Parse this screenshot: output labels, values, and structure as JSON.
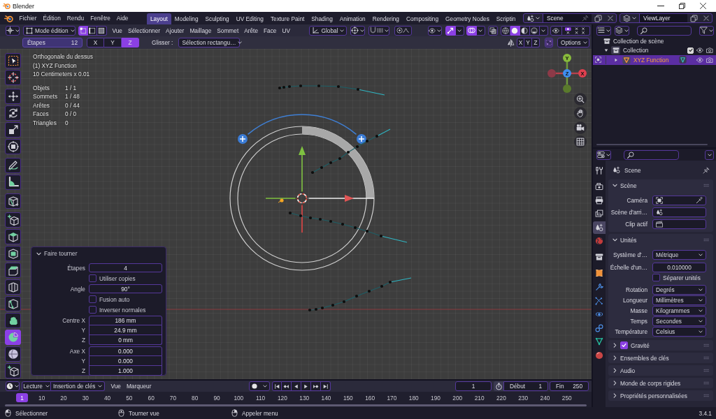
{
  "window": {
    "title": "Blender"
  },
  "menu_bar": {
    "menus": [
      "Fichier",
      "Édition",
      "Rendu",
      "Fenêtre",
      "Aide"
    ],
    "workspaces": [
      {
        "label": "Layout",
        "selected": true
      },
      {
        "label": "Modeling",
        "selected": false
      },
      {
        "label": "Sculpting",
        "selected": false
      },
      {
        "label": "UV Editing",
        "selected": false
      },
      {
        "label": "Texture Paint",
        "selected": false
      },
      {
        "label": "Shading",
        "selected": false
      },
      {
        "label": "Animation",
        "selected": false
      },
      {
        "label": "Rendering",
        "selected": false
      },
      {
        "label": "Compositing",
        "selected": false
      },
      {
        "label": "Geometry Nodes",
        "selected": false
      },
      {
        "label": "Scriptin",
        "selected": false
      }
    ],
    "scene": "Scene",
    "view_layer": "ViewLayer"
  },
  "viewport_header": {
    "mode": "Mode édition",
    "select_modes": [
      {
        "kind": "vertex",
        "selected": true
      },
      {
        "kind": "edge",
        "selected": false
      },
      {
        "kind": "face",
        "selected": false
      }
    ],
    "menus": [
      "Vue",
      "Sélectionner",
      "Ajouter",
      "Maillage",
      "Sommet",
      "Arête",
      "Face",
      "UV"
    ],
    "orientation": "Global",
    "toggles": [
      {
        "kind": "gizmo",
        "on": true
      },
      {
        "kind": "overlays",
        "on": true
      },
      {
        "kind": "xray",
        "on": false
      }
    ],
    "shading_modes": [
      {
        "kind": "wireframe",
        "selected": false
      },
      {
        "kind": "solid",
        "selected": true
      },
      {
        "kind": "material",
        "selected": false
      },
      {
        "kind": "rendered",
        "selected": false
      }
    ]
  },
  "tool_settings": {
    "steps_label": "Étapes",
    "steps": "12",
    "axes": [
      {
        "label": "X",
        "selected": false
      },
      {
        "label": "Y",
        "selected": false
      },
      {
        "label": "Z",
        "selected": true
      }
    ],
    "drag_label": "Glisser :",
    "drag_value": "Sélection rectangu…",
    "mirror_axes": [
      "X",
      "Y",
      "Z"
    ],
    "options": "Options"
  },
  "viewport": {
    "view_info": [
      "Orthogonale du dessus",
      "(1) XYZ Function",
      "10 Centimeters x 0.01"
    ],
    "stats": [
      {
        "label": "Objets",
        "value": "1 / 1"
      },
      {
        "label": "Sommets",
        "value": "1 / 48"
      },
      {
        "label": "Arêtes",
        "value": "0 / 44"
      },
      {
        "label": "Faces",
        "value": "0 / 0"
      },
      {
        "label": "Triangles",
        "value": "0"
      }
    ],
    "nav_gizmo": {
      "x": "X",
      "y": "Y",
      "z": "Z"
    }
  },
  "toolbar": {
    "groups": [
      {
        "tools": [
          {
            "kind": "select-box",
            "selected": false
          },
          {
            "kind": "cursor",
            "selected": false
          }
        ]
      },
      {
        "tools": [
          {
            "kind": "move",
            "selected": false
          },
          {
            "kind": "rotate",
            "selected": false
          },
          {
            "kind": "scale",
            "selected": false
          },
          {
            "kind": "transform",
            "selected": false
          }
        ]
      },
      {
        "tools": [
          {
            "kind": "annotate",
            "selected": false
          },
          {
            "kind": "measure",
            "selected": false
          }
        ]
      },
      {
        "tools": [
          {
            "kind": "cube-line",
            "selected": false
          }
        ]
      },
      {
        "tools": [
          {
            "kind": "cube-add",
            "selected": false
          },
          {
            "kind": "extrude",
            "selected": false
          },
          {
            "kind": "inset",
            "selected": false
          },
          {
            "kind": "bevel",
            "selected": false
          },
          {
            "kind": "loop-cut",
            "selected": false
          },
          {
            "kind": "knife",
            "selected": false
          },
          {
            "kind": "poly-build",
            "selected": false
          },
          {
            "kind": "spin",
            "selected": true
          },
          {
            "kind": "smooth",
            "selected": false
          },
          {
            "kind": "cube-add",
            "selected": false
          }
        ]
      }
    ]
  },
  "operator_panel": {
    "title": "Faire tourner",
    "expanded": true,
    "rows": [
      {
        "kind": "number",
        "label": "Étapes",
        "value": "4"
      },
      {
        "kind": "checkbox",
        "label": "Utiliser copies",
        "checked": false
      },
      {
        "kind": "number",
        "label": "Angle",
        "value": "90°"
      },
      {
        "kind": "checkbox",
        "label": "Fusion auto",
        "checked": false
      },
      {
        "kind": "checkbox",
        "label": "Inverser normales",
        "checked": false
      }
    ],
    "vectors": [
      {
        "rows": [
          {
            "label": "Centre X",
            "value": "186 mm"
          },
          {
            "label": "Y",
            "value": "24.9 mm"
          },
          {
            "label": "Z",
            "value": "0 mm"
          }
        ]
      },
      {
        "rows": [
          {
            "label": "Axe X",
            "value": "0.000"
          },
          {
            "label": "Y",
            "value": "0.000"
          },
          {
            "label": "Z",
            "value": "1.000"
          }
        ]
      }
    ]
  },
  "outliner": {
    "items": [
      {
        "label": "Collection de scène",
        "selected": false,
        "children": [
          {
            "label": "Collection",
            "selected": false,
            "expanded": true,
            "checked": true,
            "children": [
              {
                "label": "XYZ Function",
                "selected": true,
                "expanded": false
              }
            ]
          }
        ]
      }
    ]
  },
  "properties": {
    "tab_groups": [
      {
        "tabs": [
          {
            "kind": "tool",
            "selected": false
          }
        ]
      },
      {
        "tabs": [
          {
            "kind": "render",
            "selected": false
          },
          {
            "kind": "output",
            "selected": false
          },
          {
            "kind": "view-layer",
            "selected": false
          },
          {
            "kind": "scene",
            "selected": true
          },
          {
            "kind": "world",
            "selected": false
          }
        ]
      },
      {
        "tabs": [
          {
            "kind": "collection",
            "selected": false
          }
        ]
      },
      {
        "tabs": [
          {
            "kind": "object",
            "selected": false
          },
          {
            "kind": "modifiers",
            "selected": false
          },
          {
            "kind": "particles",
            "selected": false
          },
          {
            "kind": "physics",
            "selected": false
          },
          {
            "kind": "constraints",
            "selected": false
          },
          {
            "kind": "data",
            "selected": false
          },
          {
            "kind": "material",
            "selected": false
          }
        ]
      }
    ],
    "context": "Scene",
    "panels": [
      {
        "title": "Scène",
        "expanded": true,
        "rows": [
          {
            "kind": "camera",
            "label": "Caméra"
          },
          {
            "kind": "scene",
            "label": "Scène d'arri…"
          },
          {
            "kind": "clip",
            "label": "Clip actif"
          }
        ]
      },
      {
        "title": "Unités",
        "expanded": true,
        "rows": [
          {
            "kind": "dropdown",
            "label": "Système d'…",
            "value": "Métrique"
          },
          {
            "kind": "number",
            "label": "Échelle d'un…",
            "value": "0.010000"
          },
          {
            "kind": "checkbox",
            "label": "Séparer unités",
            "checked": false
          },
          {
            "kind": "dropdown",
            "label": "Rotation",
            "value": "Degrés"
          },
          {
            "kind": "dropdown",
            "label": "Longueur",
            "value": "Millimètres"
          },
          {
            "kind": "dropdown",
            "label": "Masse",
            "value": "Kilogrammes"
          },
          {
            "kind": "dropdown",
            "label": "Temps",
            "value": "Secondes"
          },
          {
            "kind": "dropdown",
            "label": "Température",
            "value": "Celsius"
          }
        ]
      },
      {
        "title": "Gravité",
        "expanded": false,
        "checked": true
      },
      {
        "title": "Ensembles de clés",
        "expanded": false
      },
      {
        "title": "Audio",
        "expanded": false
      },
      {
        "title": "Monde de corps rigides",
        "expanded": false
      },
      {
        "title": "Propriétés personnalisées",
        "expanded": false
      }
    ]
  },
  "timeline": {
    "dropdowns": [
      "Lecture",
      "Insertion de clés"
    ],
    "menus": [
      "Vue",
      "Marqueur"
    ],
    "current_frame": "1",
    "start_label": "Début",
    "start": "1",
    "end_label": "Fin",
    "end": "250",
    "frame_marker": "1",
    "ticks": [
      "10",
      "20",
      "30",
      "40",
      "50",
      "60",
      "70",
      "80",
      "90",
      "100",
      "110",
      "120",
      "130",
      "140",
      "150",
      "160",
      "170",
      "180",
      "190",
      "200",
      "210",
      "220",
      "230",
      "240",
      "250"
    ]
  },
  "status_bar": {
    "hints": [
      {
        "kind": "left",
        "label": "Sélectionner"
      },
      {
        "kind": "middle",
        "label": "Tourner vue"
      },
      {
        "kind": "right",
        "label": "Appeler menu"
      }
    ],
    "version": "3.4.1"
  }
}
